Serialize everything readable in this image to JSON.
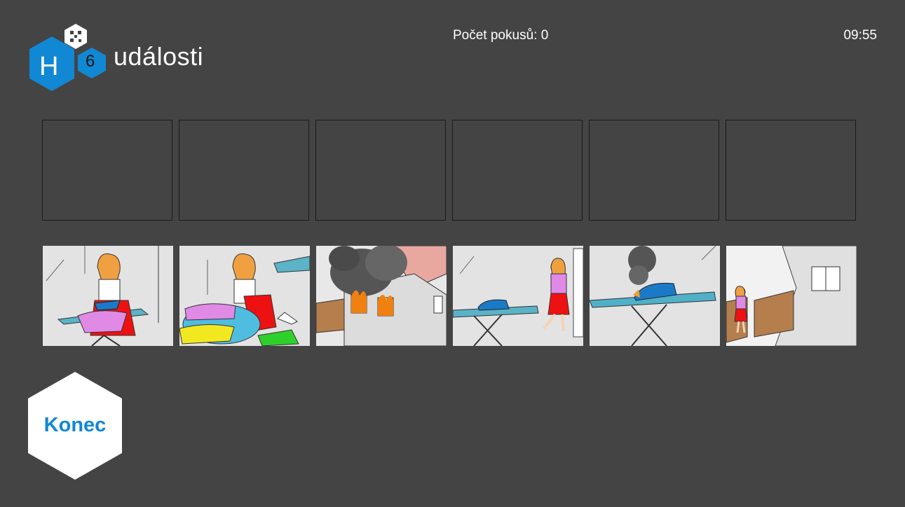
{
  "header": {
    "logo_letter": "H",
    "logo_number": "6",
    "title": "události",
    "attempts_label": "Počet pokusů: 0",
    "clock": "09:55"
  },
  "slots": [
    {
      "id": "slot-1"
    },
    {
      "id": "slot-2"
    },
    {
      "id": "slot-3"
    },
    {
      "id": "slot-4"
    },
    {
      "id": "slot-5"
    },
    {
      "id": "slot-6"
    }
  ],
  "cards": [
    {
      "name": "card-girl-ironing",
      "scene": "girl-ironing"
    },
    {
      "name": "card-girl-folding-laundry",
      "scene": "girl-laundry"
    },
    {
      "name": "card-house-on-fire",
      "scene": "house-fire"
    },
    {
      "name": "card-girl-leaving-iron-on",
      "scene": "girl-leaving"
    },
    {
      "name": "card-iron-smoking",
      "scene": "iron-smoke"
    },
    {
      "name": "card-girl-at-gate",
      "scene": "girl-gate"
    }
  ],
  "actions": {
    "end_label": "Konec"
  },
  "colors": {
    "background": "#444444",
    "brand_blue": "#1188d4",
    "hex_white": "#ffffff"
  }
}
